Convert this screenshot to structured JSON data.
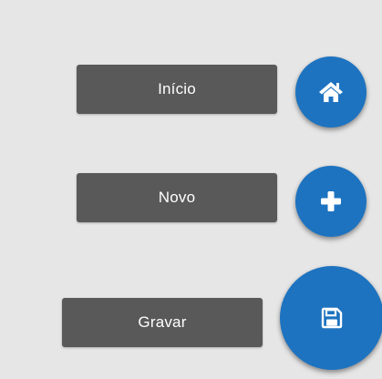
{
  "accent_color": "#1e73c0",
  "chip_color": "#595959",
  "actions": [
    {
      "label": "Início",
      "icon": "home-icon"
    },
    {
      "label": "Novo",
      "icon": "plus-icon"
    },
    {
      "label": "Gravar",
      "icon": "save-icon"
    }
  ]
}
